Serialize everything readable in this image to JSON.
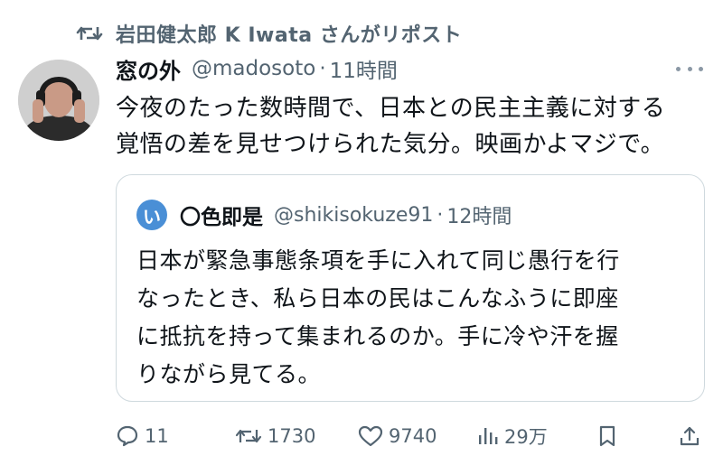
{
  "repost_banner": {
    "text": "岩田健太郎 K Iwata さんがリポスト",
    "icon": "repost-icon"
  },
  "tweet": {
    "author_name": "窓の外",
    "handle": "@madosoto",
    "separator": "·",
    "time": "11時間",
    "text_lines": [
      "今夜のたった数時間で、日本との民主主義に対する",
      "覚悟の差を見せつけられた気分。映画かよマジで。"
    ]
  },
  "quote": {
    "avatar_char": "い",
    "author_name": "〇色即是",
    "handle": "@shikisokuze91",
    "separator": "·",
    "time": "12時間",
    "text_lines": [
      "日本が緊急事態条項を手に入れて同じ愚行を行",
      "なったとき、私ら日本の民はこんなふうに即座",
      "に抵抗を持って集まれるのか。手に冷や汗を握",
      "りながら見てる。"
    ]
  },
  "actions": {
    "reply_count": "11",
    "repost_count": "1730",
    "like_count": "9740",
    "views_count": "29万"
  },
  "colors": {
    "text": "#0f1419",
    "muted": "#536471",
    "border": "#cfd9de",
    "quote_avatar": "#4a8fd6"
  }
}
